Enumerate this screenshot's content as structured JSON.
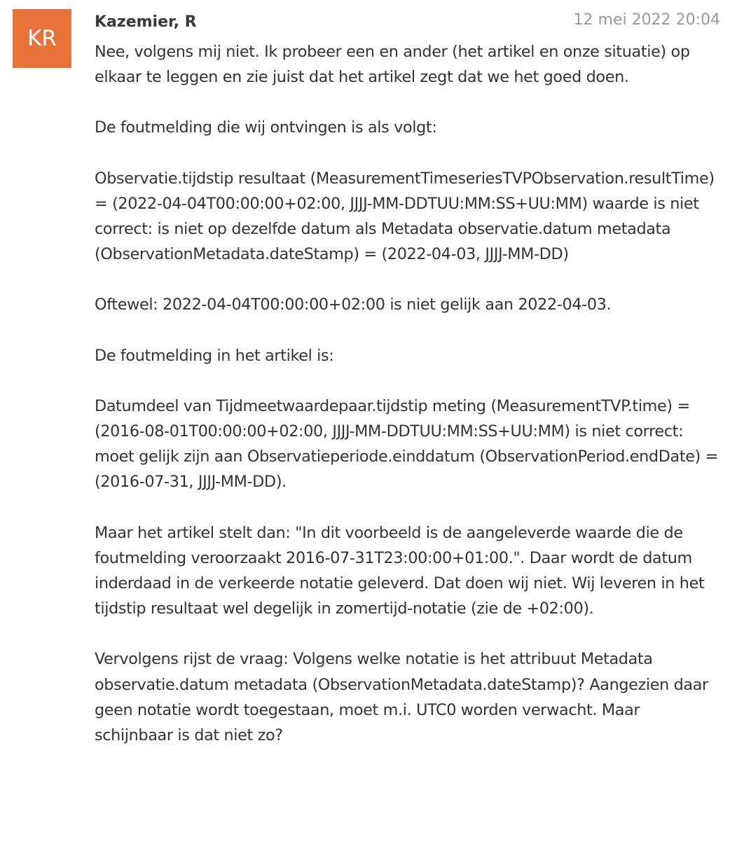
{
  "comment": {
    "avatar_initials": "KR",
    "avatar_color": "#e8743b",
    "author": "Kazemier, R",
    "timestamp": "12 mei 2022 20:04",
    "paragraphs": [
      "Nee, volgens mij niet. Ik probeer een en ander (het artikel en onze situatie) op elkaar te leggen en zie juist dat het artikel zegt dat we het goed doen.",
      "De foutmelding die wij ontvingen is als volgt:",
      "Observatie.tijdstip resultaat (MeasurementTimeseriesTVPObservation.resultTime) = (2022-04-04T00:00:00+02:00, JJJJ-MM-DDTUU:MM:SS+UU:MM) waarde is niet correct: is niet op dezelfde datum als Metadata observatie.datum metadata (ObservationMetadata.dateStamp) = (2022-04-03, JJJJ-MM-DD)",
      "Oftewel: 2022-04-04T00:00:00+02:00 is niet gelijk aan 2022-04-03.",
      "De foutmelding in het artikel is:",
      "Datumdeel van Tijdmeetwaardepaar.tijdstip meting (MeasurementTVP.time) = (2016-08-01T00:00:00+02:00, JJJJ-MM-DDTUU:MM:SS+UU:MM) is niet correct: moet gelijk zijn aan Observatieperiode.einddatum (ObservationPeriod.endDate) = (2016-07-31, JJJJ-MM-DD).",
      "Maar het artikel stelt dan: \"In dit voorbeeld is de aangeleverde waarde die de foutmelding veroorzaakt 2016-07-31T23:00:00+01:00.\". Daar wordt de datum inderdaad in de verkeerde notatie geleverd. Dat doen wij niet. Wij leveren in het tijdstip resultaat wel degelijk in zomertijd-notatie (zie de +02:00).",
      "Vervolgens rijst de vraag: Volgens welke notatie is het attribuut Metadata observatie.datum metadata (ObservationMetadata.dateStamp)? Aangezien daar geen notatie wordt toegestaan, moet m.i. UTC0 worden verwacht. Maar schijnbaar is dat niet zo?"
    ]
  }
}
